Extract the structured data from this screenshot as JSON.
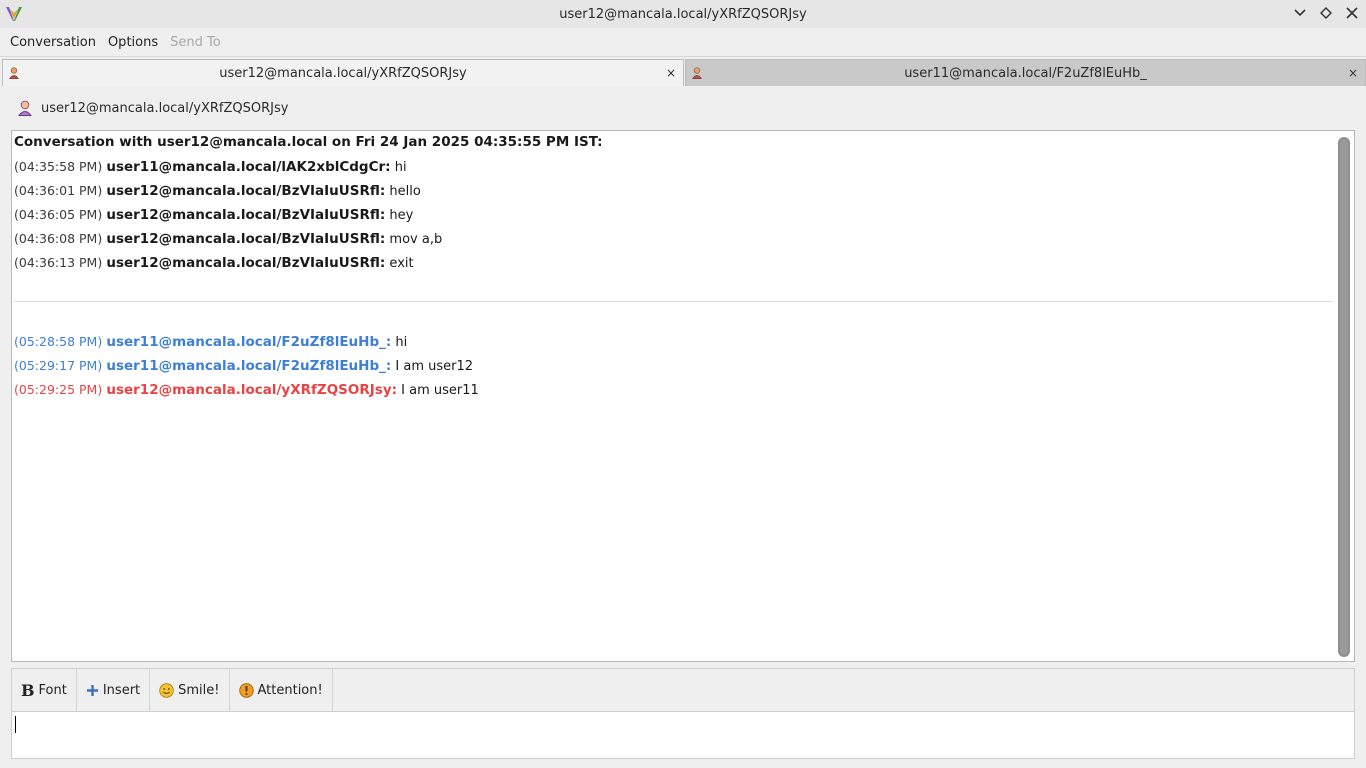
{
  "window": {
    "title": "user12@mancala.local/yXRfZQSORJsy",
    "buttons": [
      "minimize",
      "maximize",
      "close"
    ]
  },
  "menu": {
    "items": [
      {
        "label": "Conversation",
        "enabled": true
      },
      {
        "label": "Options",
        "enabled": true
      },
      {
        "label": "Send To",
        "enabled": false
      }
    ]
  },
  "tabs": [
    {
      "label": "user12@mancala.local/yXRfZQSORJsy",
      "active": true,
      "close": "×"
    },
    {
      "label": "user11@mancala.local/F2uZf8lEuHb_",
      "active": false,
      "close": "×"
    }
  ],
  "buddy": {
    "name": "user12@mancala.local/yXRfZQSORJsy",
    "icon": "user-icon"
  },
  "history": {
    "header": "Conversation with user12@mancala.local on Fri 24 Jan 2025 04:35:55 PM IST:",
    "old_messages": [
      {
        "time": "(04:35:58 PM)",
        "sender": "user11@mancala.local/lAK2xblCdgCr:",
        "text": "hi"
      },
      {
        "time": "(04:36:01 PM)",
        "sender": "user12@mancala.local/BzVIaIuUSRfl:",
        "text": "hello"
      },
      {
        "time": "(04:36:05 PM)",
        "sender": "user12@mancala.local/BzVIaIuUSRfl:",
        "text": "hey"
      },
      {
        "time": "(04:36:08 PM)",
        "sender": "user12@mancala.local/BzVIaIuUSRfl:",
        "text": "mov a,b"
      },
      {
        "time": "(04:36:13 PM)",
        "sender": "user12@mancala.local/BzVIaIuUSRfl:",
        "text": "exit"
      }
    ],
    "new_messages": [
      {
        "time": "(05:28:58 PM)",
        "sender": "user11@mancala.local/F2uZf8lEuHb_:",
        "text": "hi",
        "kind": "recv"
      },
      {
        "time": "(05:29:17 PM)",
        "sender": "user11@mancala.local/F2uZf8lEuHb_:",
        "text": "I am user12",
        "kind": "recv"
      },
      {
        "time": "(05:29:25 PM)",
        "sender": "user12@mancala.local/yXRfZQSORJsy:",
        "text": "I am user11",
        "kind": "sent"
      }
    ]
  },
  "toolbar": {
    "font_label": "Font",
    "insert_label": "Insert",
    "smile_label": "Smile!",
    "attention_label": "Attention!"
  },
  "entry": {
    "value": ""
  },
  "colors": {
    "received": "#3d7fd4",
    "sent": "#e84343"
  }
}
